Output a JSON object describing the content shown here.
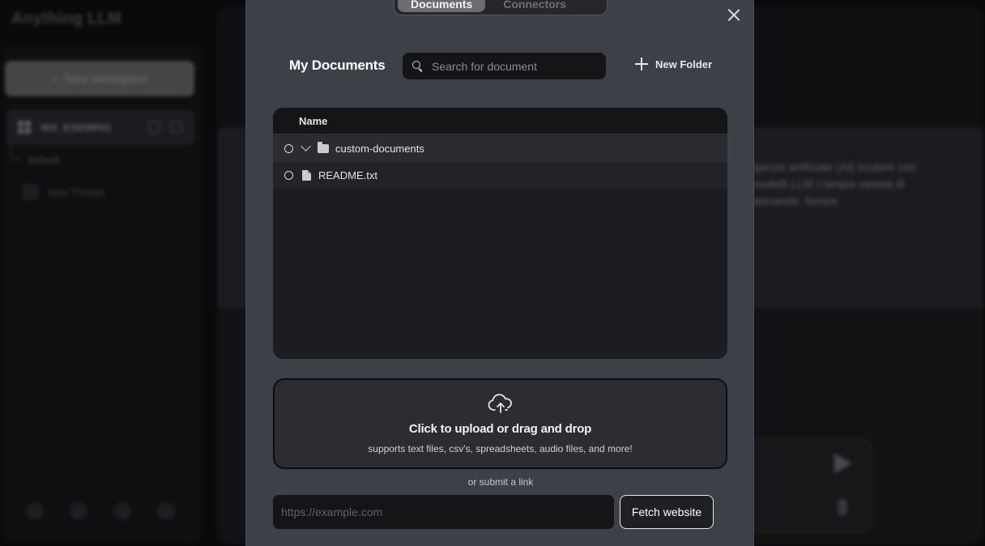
{
  "app": {
    "logo": "Anything LLM",
    "new_workspace": "New Workspace",
    "workspace_name": "WS_ESEMPIO",
    "thread_default": "default",
    "new_thread": "New Thread",
    "message_preview": "igenza artificiale (AI) scutere con modelli LLM n'ampia varietà di domande, fornire"
  },
  "modal": {
    "tabs": [
      {
        "label": "Documents",
        "active": true
      },
      {
        "label": "Data Connectors",
        "active": false
      }
    ],
    "title": "My Documents",
    "search_placeholder": "Search for document",
    "new_folder_label": "New Folder",
    "table": {
      "column_header": "Name",
      "rows": [
        {
          "type": "folder",
          "name": "custom-documents",
          "expanded": true
        },
        {
          "type": "file",
          "name": "README.txt"
        }
      ]
    },
    "upload": {
      "title": "Click to upload or drag and drop",
      "subtitle": "supports text files, csv's, spreadsheets, audio files, and more!"
    },
    "or_link_text": "or submit a link",
    "url_placeholder": "https://example.com",
    "fetch_button": "Fetch website"
  },
  "colors": {
    "modal_bg": "#3d4047",
    "table_bg": "#1c1d20",
    "input_bg": "#141517"
  }
}
